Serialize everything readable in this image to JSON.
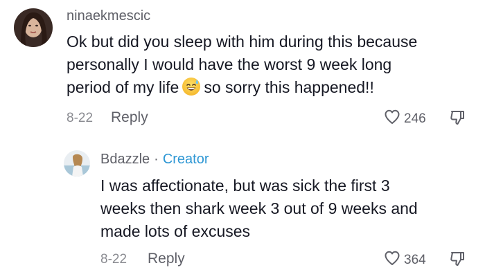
{
  "comment": {
    "username": "ninaekmescic",
    "lines": [
      "Ok but did you sleep with him during this because",
      "personally I would have the worst 9 week long",
      "period of my life",
      "so sorry this happened!!"
    ],
    "emoji": "grinning-face-with-sweat-icon",
    "date": "8-22",
    "reply_label": "Reply",
    "likes": "246"
  },
  "reply": {
    "username": "Bdazzle",
    "separator": "·",
    "badge": "Creator",
    "lines": [
      "I was affectionate, but was sick the first 3",
      "weeks then shark week 3 out of 9 weeks and",
      "made lots of excuses"
    ],
    "date": "8-22",
    "reply_label": "Reply",
    "likes": "364"
  },
  "colors": {
    "text": "#161823",
    "muted": "#5f6068",
    "date": "#8a8b91",
    "creator_badge": "#2e97d4"
  }
}
